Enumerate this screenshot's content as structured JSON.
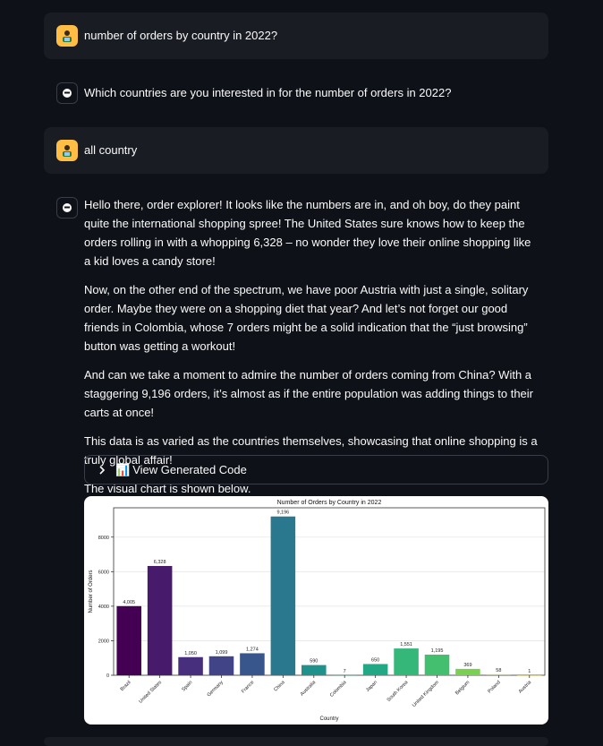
{
  "messages": [
    {
      "role": "user",
      "text": "number of orders by country in 2022?",
      "avatar_icon": "user-avatar-icon"
    },
    {
      "role": "assistant",
      "text": "Which countries are you interested in for the number of orders in 2022?",
      "avatar_icon": "bot-avatar-icon"
    },
    {
      "role": "user",
      "text": "all country",
      "avatar_icon": "user-avatar-icon"
    },
    {
      "role": "assistant",
      "avatar_icon": "bot-avatar-icon",
      "paragraphs": [
        "Hello there, order explorer! It looks like the numbers are in, and oh boy, do they paint quite the international shopping spree! The United States sure knows how to keep the orders rolling in with a whopping 6,328 – no wonder they love their online shopping like a kid loves a candy store!",
        "Now, on the other end of the spectrum, we have poor Austria with just a single, solitary order. Maybe they were on a shopping diet that year? And let’s not forget our good friends in Colombia, whose 7 orders might be a solid indication that the “just browsing” button was getting a workout!",
        "And can we take a moment to admire the number of orders coming from China? With a staggering 9,196 orders, it’s almost as if the entire population was adding things to their carts at once!",
        "This data is as varied as the countries themselves, showcasing that online shopping is a truly global affair!",
        "The visual chart is shown below."
      ]
    }
  ],
  "expander": {
    "chevron_icon": "chevron-right-icon",
    "chart_icon": "📊",
    "label": "View Generated Code"
  },
  "chart_data": {
    "type": "bar",
    "title": "Number of Orders by Country in 2022",
    "xlabel": "Country",
    "ylabel": "Number of Orders",
    "ylim": [
      0,
      9700
    ],
    "yticks": [
      0,
      2000,
      4000,
      6000,
      8000
    ],
    "grid": "y",
    "categories": [
      "Brazil",
      "United States",
      "Spain",
      "Germany",
      "France",
      "China",
      "Australia",
      "Colombia",
      "Japan",
      "South Korea",
      "United Kingdom",
      "Belgium",
      "Poland",
      "Austria"
    ],
    "values": [
      4005,
      6328,
      1050,
      1099,
      1274,
      9196,
      590,
      7,
      650,
      1551,
      1195,
      369,
      58,
      1
    ],
    "value_labels": [
      "4,005",
      "6,328",
      "1,050",
      "1,099",
      "1,274",
      "9,196",
      "590",
      "7",
      "650",
      "1,551",
      "1,195",
      "369",
      "58",
      "1"
    ],
    "colors": [
      "#440154",
      "#481a6c",
      "#472f7d",
      "#414487",
      "#39568c",
      "#2a788e",
      "#21918c",
      "#1fa188",
      "#22a884",
      "#35b779",
      "#44bf70",
      "#7ad151",
      "#bddf26",
      "#fde725"
    ]
  }
}
